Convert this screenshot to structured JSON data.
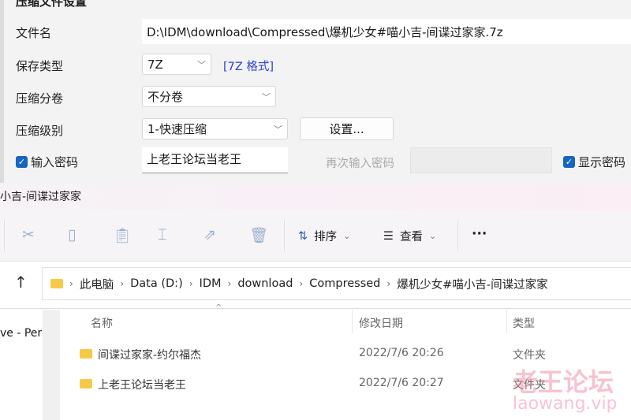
{
  "dialog": {
    "title": "压缩文件设置",
    "filename_label": "文件名",
    "filename_value": "D:\\IDM\\download\\Compressed\\爆机少女#喵小吉-间谍过家家.7z",
    "type_label": "保存类型",
    "type_value": "7Z",
    "type_link": "[7Z 格式]",
    "split_label": "压缩分卷",
    "split_value": "不分卷",
    "level_label": "压缩级别",
    "level_value": "1-快速压缩",
    "settings_button": "设置...",
    "password_checkbox": "输入密码",
    "password_value": "上老王论坛当老王",
    "repeat_label": "再次输入密码",
    "repeat_value": "",
    "show_password": "显示密码",
    "link_color": "#2a3fd6",
    "accent": "#1665c0"
  },
  "explorer": {
    "title": "小吉-间谍过家家",
    "toolbar": {
      "sort": "排序",
      "view": "查看",
      "more": "···"
    },
    "breadcrumb": [
      "此电脑",
      "Data (D:)",
      "IDM",
      "download",
      "Compressed",
      "爆机少女#喵小吉-间谍过家家"
    ],
    "nav_item": "ve - Pers",
    "columns": [
      "名称",
      "修改日期",
      "类型"
    ],
    "rows": [
      {
        "name": "间谍过家家-约尔福杰",
        "date": "2022/7/6 20:26",
        "type": "文件夹"
      },
      {
        "name": "上老王论坛当老王",
        "date": "2022/7/6 20:27",
        "type": "文件夹"
      }
    ]
  },
  "watermark": {
    "text": "老王论坛",
    "url": "laowang.vip"
  }
}
